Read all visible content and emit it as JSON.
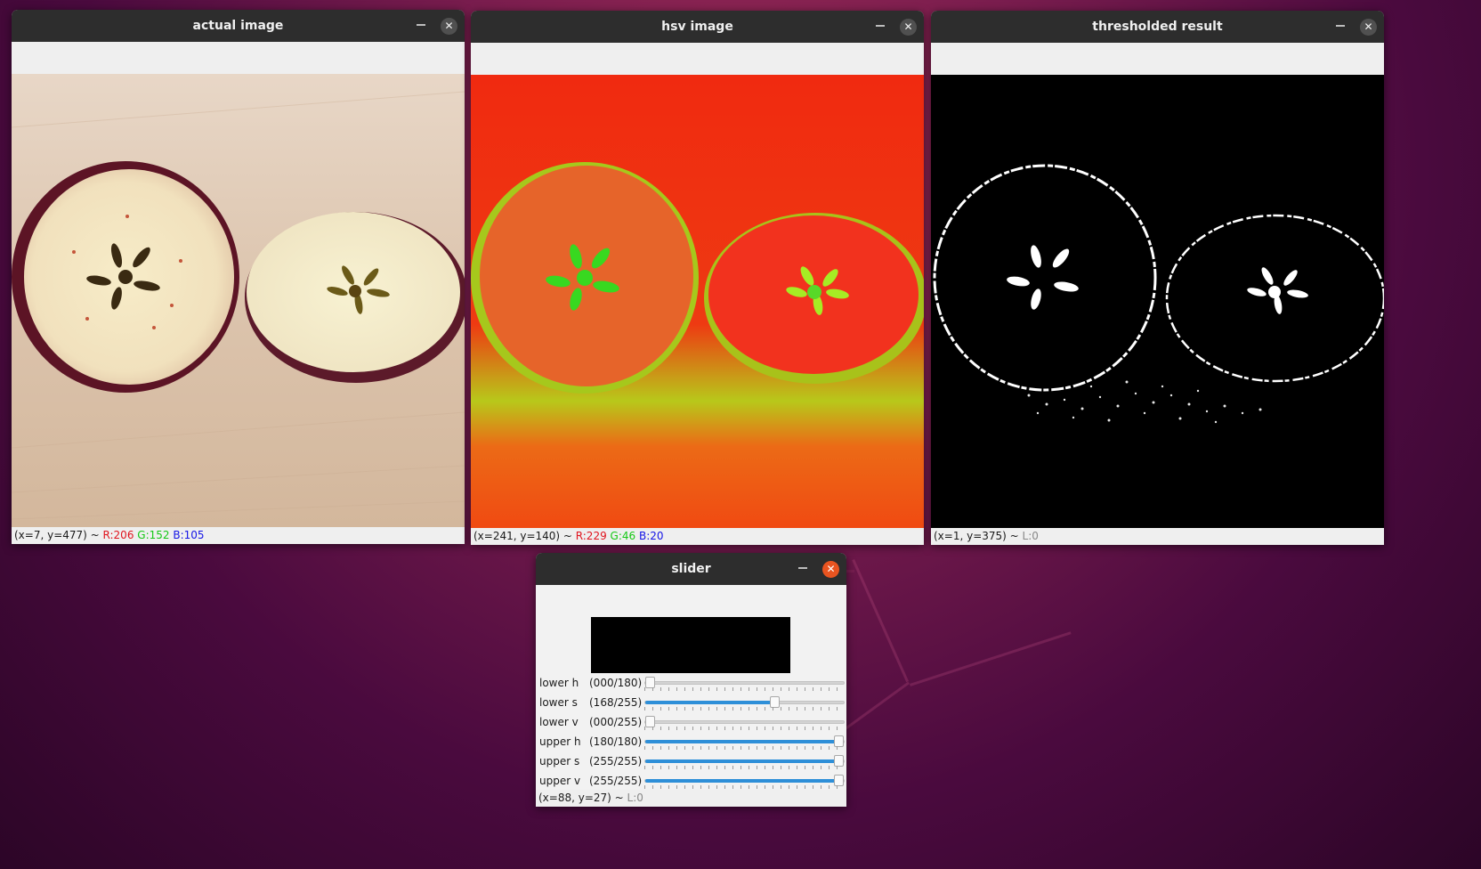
{
  "windows": {
    "actual": {
      "title": "actual image",
      "status": {
        "coords": "(x=7, y=477) ~ ",
        "r": "R:206",
        "g": "G:152",
        "b": "B:105"
      }
    },
    "hsv": {
      "title": "hsv image",
      "status": {
        "coords": "(x=241, y=140) ~ ",
        "r": "R:229",
        "g": "G:46",
        "b": "B:20"
      }
    },
    "thresh": {
      "title": "thresholded result",
      "status": {
        "coords": "(x=1, y=375) ~ ",
        "l": "L:0"
      }
    },
    "slider": {
      "title": "slider",
      "status": {
        "coords": "(x=88, y=27) ~ ",
        "l": "L:0"
      },
      "trackbars": [
        {
          "label": "lower h",
          "value": "(000/180)",
          "fraction": 0.0
        },
        {
          "label": "lower s",
          "value": "(168/255)",
          "fraction": 0.659
        },
        {
          "label": "lower v",
          "value": "(000/255)",
          "fraction": 0.0
        },
        {
          "label": "upper h",
          "value": "(180/180)",
          "fraction": 1.0
        },
        {
          "label": "upper s",
          "value": "(255/255)",
          "fraction": 1.0
        },
        {
          "label": "upper v",
          "value": "(255/255)",
          "fraction": 1.0
        }
      ]
    }
  },
  "controls": {
    "minimize": "–",
    "close": "✕"
  },
  "colors": {
    "accent": "#2e8fd8",
    "close_active": "#e95420"
  }
}
